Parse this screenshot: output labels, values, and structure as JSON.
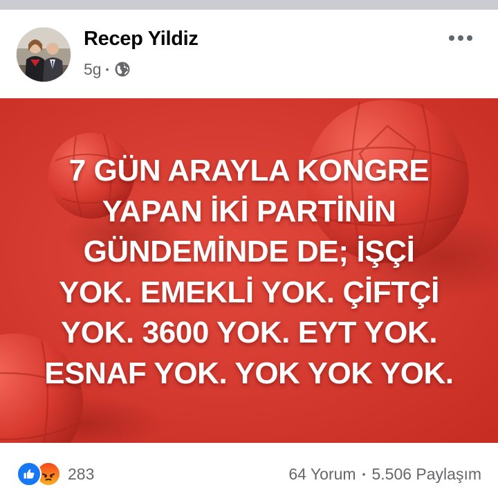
{
  "post": {
    "author": "Recep Yildiz",
    "time": "5g",
    "separator": "•",
    "audience_icon": "globe-icon",
    "more_icon": "more-horizontal-icon",
    "image_text_lines": [
      "7 GÜN ARAYLA KONGRE",
      "YAPAN İKİ PARTİNİN",
      "GÜNDEMİNDE DE; İŞÇİ",
      "YOK. EMEKLİ YOK. ÇİFTÇİ",
      "YOK. 3600 YOK. EYT YOK.",
      "ESNAF YOK. YOK YOK YOK."
    ],
    "image_colors": {
      "background": "#d93a2e",
      "ball": "#e0463a",
      "text": "#ffffff"
    }
  },
  "footer": {
    "reaction_icons": [
      "like-icon",
      "angry-icon"
    ],
    "reaction_count": "283",
    "comments": "64 Yorum",
    "separator": "•",
    "shares": "5.506 Paylaşım"
  },
  "colors": {
    "like": "#1877f2",
    "secondary_text": "#65676b",
    "primary_text": "#050505"
  }
}
